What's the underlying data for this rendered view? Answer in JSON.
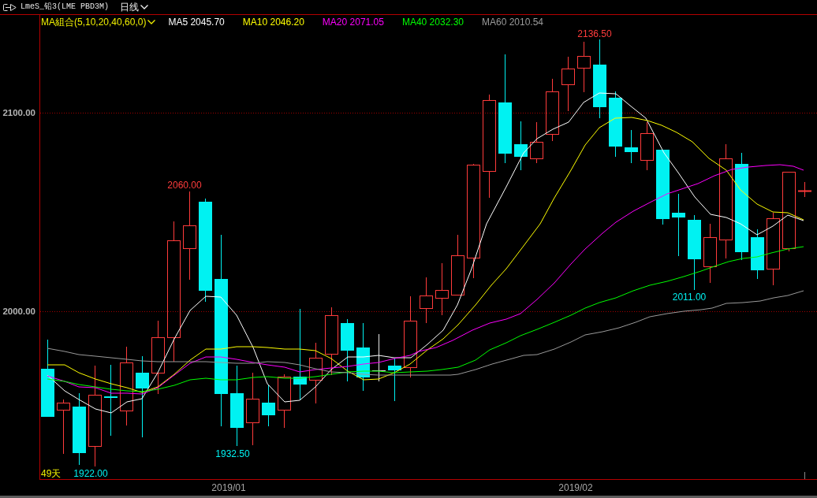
{
  "header": {
    "symbol": "LmeS_铅3(LME PBD3M)",
    "period": "日线"
  },
  "legend": {
    "indicator": "MA組合(5,10,20,40,60,0)",
    "lines": [
      {
        "label": "MA5 2045.70",
        "color": "#ffffff"
      },
      {
        "label": "MA10 2046.20",
        "color": "#ffff00"
      },
      {
        "label": "MA20 2071.05",
        "color": "#ff00ff"
      },
      {
        "label": "MA40 2032.30",
        "color": "#00ff00"
      },
      {
        "label": "MA60 2010.54",
        "color": "#9a9a9a"
      }
    ]
  },
  "y_axis": {
    "ticks": [
      "2100.00",
      "2000.00"
    ]
  },
  "chart_labels": [
    {
      "kind": "high",
      "text": "2060.00"
    },
    {
      "kind": "low",
      "text": "1932.50"
    },
    {
      "kind": "high",
      "text": "2136.50"
    },
    {
      "kind": "low",
      "text": "2011.00"
    },
    {
      "kind": "low",
      "text": "1922.00"
    }
  ],
  "day_count": "49天",
  "x_axis": {
    "ticks": [
      "2019/01",
      "2019/02"
    ]
  }
}
